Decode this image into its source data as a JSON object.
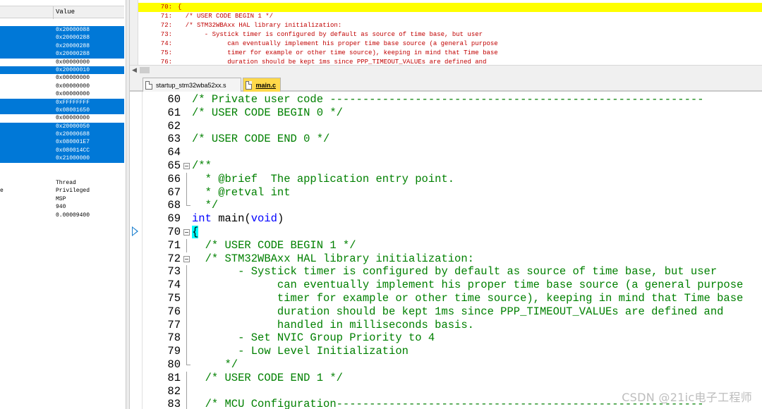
{
  "registers": {
    "value_header": "Value",
    "rows": [
      {
        "value": "0x20000088",
        "selected": true
      },
      {
        "value": "0x20000288",
        "selected": true
      },
      {
        "value": "0x20000288",
        "selected": true
      },
      {
        "value": "0x20000288",
        "selected": true
      },
      {
        "value": "0x00000000",
        "selected": false
      },
      {
        "value": "0x20000010",
        "selected": true
      },
      {
        "value": "0x00000000",
        "selected": false
      },
      {
        "value": "0x00000000",
        "selected": false
      },
      {
        "value": "0x00000000",
        "selected": false
      },
      {
        "value": "0xFFFFFFFF",
        "selected": true
      },
      {
        "value": "0x08001650",
        "selected": true
      },
      {
        "value": "0x00000000",
        "selected": false
      },
      {
        "value": "0x20000050",
        "selected": true
      },
      {
        "value": "0x20000688",
        "selected": true
      },
      {
        "value": "0x080001E7",
        "selected": true
      },
      {
        "value": "0x080014CC",
        "selected": true
      },
      {
        "value": "0x21000000",
        "selected": true
      }
    ],
    "mode_rows": [
      {
        "edge": "",
        "value": "Thread"
      },
      {
        "edge": "e",
        "value": "Privileged"
      },
      {
        "edge": "",
        "value": "MSP"
      },
      {
        "edge": "",
        "value": "940"
      },
      {
        "edge": "",
        "value": "0.00009400"
      }
    ]
  },
  "disassembly": {
    "lines": [
      {
        "num": "70:",
        "text": "{",
        "current": true
      },
      {
        "num": "71:",
        "text": "  /* USER CODE BEGIN 1 */",
        "current": false
      },
      {
        "num": "72:",
        "text": "  /* STM32WBAxx HAL library initialization:",
        "current": false
      },
      {
        "num": "73:",
        "text": "       - Systick timer is configured by default as source of time base, but user",
        "current": false
      },
      {
        "num": "74:",
        "text": "             can eventually implement his proper time base source (a general purpose",
        "current": false
      },
      {
        "num": "75:",
        "text": "             timer for example or other time source), keeping in mind that Time base",
        "current": false
      },
      {
        "num": "76:",
        "text": "             duration should be kept 1ms since PPP_TIMEOUT_VALUEs are defined and",
        "current": false
      }
    ]
  },
  "tabs": [
    {
      "label": "startup_stm32wba52xx.s",
      "active": false
    },
    {
      "label": "main.c",
      "active": true
    }
  ],
  "editor": {
    "current_line": "70",
    "lines": [
      {
        "num": "60",
        "parts": [
          {
            "t": "/* Private user code ---------------------------------------------------------",
            "c": "comment"
          }
        ]
      },
      {
        "num": "61",
        "parts": [
          {
            "t": "/* USER CODE BEGIN 0 */",
            "c": "comment"
          }
        ]
      },
      {
        "num": "62",
        "parts": []
      },
      {
        "num": "63",
        "parts": [
          {
            "t": "/* USER CODE END 0 */",
            "c": "comment"
          }
        ]
      },
      {
        "num": "64",
        "parts": []
      },
      {
        "num": "65",
        "parts": [
          {
            "t": "/**",
            "c": "comment"
          }
        ],
        "fold": "open"
      },
      {
        "num": "66",
        "parts": [
          {
            "t": "  * @brief  The application entry point.",
            "c": "comment"
          }
        ],
        "fold": "bar"
      },
      {
        "num": "67",
        "parts": [
          {
            "t": "  * @retval int",
            "c": "comment"
          }
        ],
        "fold": "bar"
      },
      {
        "num": "68",
        "parts": [
          {
            "t": "  */",
            "c": "comment"
          }
        ],
        "fold": "end"
      },
      {
        "num": "69",
        "parts": [
          {
            "t": "int",
            "c": "kw"
          },
          {
            "t": " main(",
            "c": "plain"
          },
          {
            "t": "void",
            "c": "kw"
          },
          {
            "t": ")",
            "c": "plain"
          }
        ]
      },
      {
        "num": "70",
        "parts": [
          {
            "t": "{",
            "c": "brace"
          }
        ],
        "fold": "open"
      },
      {
        "num": "71",
        "parts": [
          {
            "t": "  /* USER CODE BEGIN 1 */",
            "c": "comment"
          }
        ],
        "fold": "bar"
      },
      {
        "num": "72",
        "parts": [
          {
            "t": "  /* STM32WBAxx HAL library initialization:",
            "c": "comment"
          }
        ],
        "fold": "open"
      },
      {
        "num": "73",
        "parts": [
          {
            "t": "       - Systick timer is configured by default as source of time base, but user",
            "c": "comment"
          }
        ],
        "fold": "bar"
      },
      {
        "num": "74",
        "parts": [
          {
            "t": "             can eventually implement his proper time base source (a general purpose",
            "c": "comment"
          }
        ],
        "fold": "bar"
      },
      {
        "num": "75",
        "parts": [
          {
            "t": "             timer for example or other time source), keeping in mind that Time base",
            "c": "comment"
          }
        ],
        "fold": "bar"
      },
      {
        "num": "76",
        "parts": [
          {
            "t": "             duration should be kept 1ms since PPP_TIMEOUT_VALUEs are defined and",
            "c": "comment"
          }
        ],
        "fold": "bar"
      },
      {
        "num": "77",
        "parts": [
          {
            "t": "             handled in milliseconds basis.",
            "c": "comment"
          }
        ],
        "fold": "bar"
      },
      {
        "num": "78",
        "parts": [
          {
            "t": "       - Set NVIC Group Priority to 4",
            "c": "comment"
          }
        ],
        "fold": "bar"
      },
      {
        "num": "79",
        "parts": [
          {
            "t": "       - Low Level Initialization",
            "c": "comment"
          }
        ],
        "fold": "bar"
      },
      {
        "num": "80",
        "parts": [
          {
            "t": "     */",
            "c": "comment"
          }
        ],
        "fold": "end"
      },
      {
        "num": "81",
        "parts": [
          {
            "t": "  /* USER CODE END 1 */",
            "c": "comment"
          }
        ],
        "fold": "bar"
      },
      {
        "num": "82",
        "parts": [],
        "fold": "bar"
      },
      {
        "num": "83",
        "parts": [
          {
            "t": "  /* MCU Configuration--------------------------------------------------------",
            "c": "comment"
          }
        ],
        "fold": "bar"
      }
    ]
  },
  "watermark": "CSDN @21ic电子工程师",
  "colors": {
    "selection": "#0078d7",
    "disasm_current_line": "#ffff00",
    "disasm_text": "#c00000",
    "comment": "#008000",
    "keyword": "#0000ff",
    "brace_highlight": "#00ffff",
    "active_tab": "#ffd94a"
  }
}
